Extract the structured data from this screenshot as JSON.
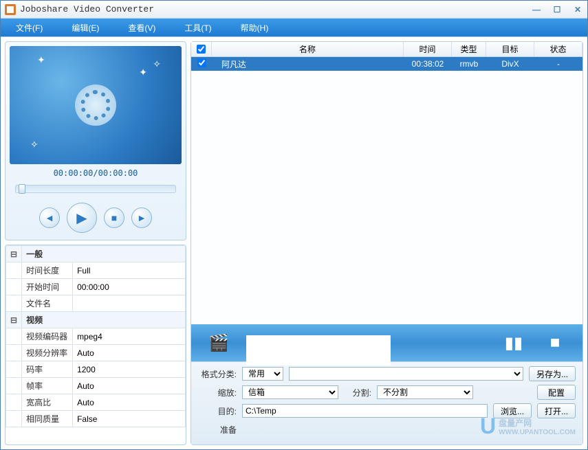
{
  "title": "Joboshare Video Converter",
  "menu": {
    "file": "文件(F)",
    "edit": "编辑(E)",
    "view": "查看(V)",
    "tools": "工具(T)",
    "help": "帮助(H)"
  },
  "preview": {
    "time": "00:00:00/00:00:00"
  },
  "props": {
    "general": {
      "header": "一般",
      "duration_label": "时间长度",
      "duration": "Full",
      "start_label": "开始时间",
      "start": "00:00:00",
      "filename_label": "文件名",
      "filename": ""
    },
    "video": {
      "header": "视频",
      "codec_label": "视频编码器",
      "codec": "mpeg4",
      "res_label": "视频分辨率",
      "res": "Auto",
      "bitrate_label": "码率",
      "bitrate": "1200",
      "fps_label": "帧率",
      "fps": "Auto",
      "aspect_label": "宽高比",
      "aspect": "Auto",
      "extra_label": "相同质量",
      "extra": "False"
    }
  },
  "table": {
    "headers": {
      "name": "名称",
      "time": "时间",
      "type": "类型",
      "target": "目标",
      "status": "状态"
    },
    "rows": [
      {
        "name": "阿凡达",
        "time": "00:38:02",
        "type": "rmvb",
        "target": "DivX",
        "status": "-"
      }
    ]
  },
  "settings": {
    "format_label": "格式分类:",
    "format": "常用",
    "saveas": "另存为...",
    "zoom_label": "缩放:",
    "zoom": "信箱",
    "split_label": "分割:",
    "split": "不分割",
    "config": "配置",
    "dest_label": "目的:",
    "dest": "C:\\Temp",
    "browse": "浏览...",
    "open": "打开...",
    "ready_label": "准备"
  },
  "watermark": {
    "text": "盘量产网",
    "url": "WWW.UPANTOOL.COM"
  }
}
